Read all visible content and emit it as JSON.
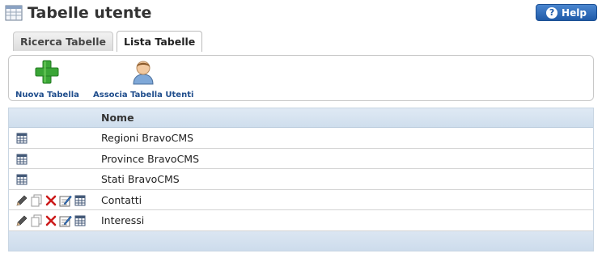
{
  "header": {
    "title": "Tabelle utente",
    "help_label": "Help"
  },
  "tabs": [
    {
      "label": "Ricerca Tabelle",
      "active": false
    },
    {
      "label": "Lista Tabelle",
      "active": true
    }
  ],
  "toolbar": {
    "new_table_label": "Nuova Tabella",
    "assoc_users_label": "Associa Tabella Utenti"
  },
  "grid": {
    "column_name_header": "Nome",
    "rows": [
      {
        "name": "Regioni BravoCMS",
        "icons": [
          "table-icon"
        ]
      },
      {
        "name": "Province BravoCMS",
        "icons": [
          "table-icon"
        ]
      },
      {
        "name": "Stati BravoCMS",
        "icons": [
          "table-icon"
        ]
      },
      {
        "name": "Contatti",
        "icons": [
          "edit-pencil-icon",
          "copy-icon",
          "delete-icon",
          "edit-fields-icon",
          "table-icon"
        ]
      },
      {
        "name": "Interessi",
        "icons": [
          "edit-pencil-icon",
          "copy-icon",
          "delete-icon",
          "edit-fields-icon",
          "table-icon"
        ]
      }
    ]
  },
  "colors": {
    "accent_blue": "#1f5aa8",
    "link_blue": "#1f4d8c",
    "header_bg": "#dfe9f4",
    "green_plus": "#3aa536",
    "delete_red": "#cc1b1b"
  }
}
